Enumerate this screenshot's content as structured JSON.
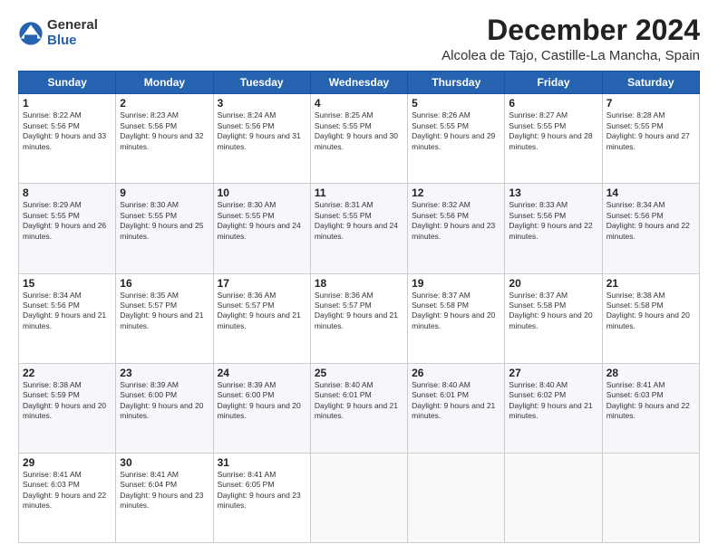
{
  "header": {
    "logo": {
      "general": "General",
      "blue": "Blue"
    },
    "month": "December 2024",
    "location": "Alcolea de Tajo, Castille-La Mancha, Spain"
  },
  "weekdays": [
    "Sunday",
    "Monday",
    "Tuesday",
    "Wednesday",
    "Thursday",
    "Friday",
    "Saturday"
  ],
  "weeks": [
    [
      {
        "day": "1",
        "sunrise": "8:22 AM",
        "sunset": "5:56 PM",
        "daylight": "9 hours and 33 minutes."
      },
      {
        "day": "2",
        "sunrise": "8:23 AM",
        "sunset": "5:56 PM",
        "daylight": "9 hours and 32 minutes."
      },
      {
        "day": "3",
        "sunrise": "8:24 AM",
        "sunset": "5:56 PM",
        "daylight": "9 hours and 31 minutes."
      },
      {
        "day": "4",
        "sunrise": "8:25 AM",
        "sunset": "5:55 PM",
        "daylight": "9 hours and 30 minutes."
      },
      {
        "day": "5",
        "sunrise": "8:26 AM",
        "sunset": "5:55 PM",
        "daylight": "9 hours and 29 minutes."
      },
      {
        "day": "6",
        "sunrise": "8:27 AM",
        "sunset": "5:55 PM",
        "daylight": "9 hours and 28 minutes."
      },
      {
        "day": "7",
        "sunrise": "8:28 AM",
        "sunset": "5:55 PM",
        "daylight": "9 hours and 27 minutes."
      }
    ],
    [
      {
        "day": "8",
        "sunrise": "8:29 AM",
        "sunset": "5:55 PM",
        "daylight": "9 hours and 26 minutes."
      },
      {
        "day": "9",
        "sunrise": "8:30 AM",
        "sunset": "5:55 PM",
        "daylight": "9 hours and 25 minutes."
      },
      {
        "day": "10",
        "sunrise": "8:30 AM",
        "sunset": "5:55 PM",
        "daylight": "9 hours and 24 minutes."
      },
      {
        "day": "11",
        "sunrise": "8:31 AM",
        "sunset": "5:55 PM",
        "daylight": "9 hours and 24 minutes."
      },
      {
        "day": "12",
        "sunrise": "8:32 AM",
        "sunset": "5:56 PM",
        "daylight": "9 hours and 23 minutes."
      },
      {
        "day": "13",
        "sunrise": "8:33 AM",
        "sunset": "5:56 PM",
        "daylight": "9 hours and 22 minutes."
      },
      {
        "day": "14",
        "sunrise": "8:34 AM",
        "sunset": "5:56 PM",
        "daylight": "9 hours and 22 minutes."
      }
    ],
    [
      {
        "day": "15",
        "sunrise": "8:34 AM",
        "sunset": "5:56 PM",
        "daylight": "9 hours and 21 minutes."
      },
      {
        "day": "16",
        "sunrise": "8:35 AM",
        "sunset": "5:57 PM",
        "daylight": "9 hours and 21 minutes."
      },
      {
        "day": "17",
        "sunrise": "8:36 AM",
        "sunset": "5:57 PM",
        "daylight": "9 hours and 21 minutes."
      },
      {
        "day": "18",
        "sunrise": "8:36 AM",
        "sunset": "5:57 PM",
        "daylight": "9 hours and 21 minutes."
      },
      {
        "day": "19",
        "sunrise": "8:37 AM",
        "sunset": "5:58 PM",
        "daylight": "9 hours and 20 minutes."
      },
      {
        "day": "20",
        "sunrise": "8:37 AM",
        "sunset": "5:58 PM",
        "daylight": "9 hours and 20 minutes."
      },
      {
        "day": "21",
        "sunrise": "8:38 AM",
        "sunset": "5:58 PM",
        "daylight": "9 hours and 20 minutes."
      }
    ],
    [
      {
        "day": "22",
        "sunrise": "8:38 AM",
        "sunset": "5:59 PM",
        "daylight": "9 hours and 20 minutes."
      },
      {
        "day": "23",
        "sunrise": "8:39 AM",
        "sunset": "6:00 PM",
        "daylight": "9 hours and 20 minutes."
      },
      {
        "day": "24",
        "sunrise": "8:39 AM",
        "sunset": "6:00 PM",
        "daylight": "9 hours and 20 minutes."
      },
      {
        "day": "25",
        "sunrise": "8:40 AM",
        "sunset": "6:01 PM",
        "daylight": "9 hours and 21 minutes."
      },
      {
        "day": "26",
        "sunrise": "8:40 AM",
        "sunset": "6:01 PM",
        "daylight": "9 hours and 21 minutes."
      },
      {
        "day": "27",
        "sunrise": "8:40 AM",
        "sunset": "6:02 PM",
        "daylight": "9 hours and 21 minutes."
      },
      {
        "day": "28",
        "sunrise": "8:41 AM",
        "sunset": "6:03 PM",
        "daylight": "9 hours and 22 minutes."
      }
    ],
    [
      {
        "day": "29",
        "sunrise": "8:41 AM",
        "sunset": "6:03 PM",
        "daylight": "9 hours and 22 minutes."
      },
      {
        "day": "30",
        "sunrise": "8:41 AM",
        "sunset": "6:04 PM",
        "daylight": "9 hours and 23 minutes."
      },
      {
        "day": "31",
        "sunrise": "8:41 AM",
        "sunset": "6:05 PM",
        "daylight": "9 hours and 23 minutes."
      },
      null,
      null,
      null,
      null
    ]
  ],
  "labels": {
    "sunrise": "Sunrise:",
    "sunset": "Sunset:",
    "daylight": "Daylight:"
  }
}
